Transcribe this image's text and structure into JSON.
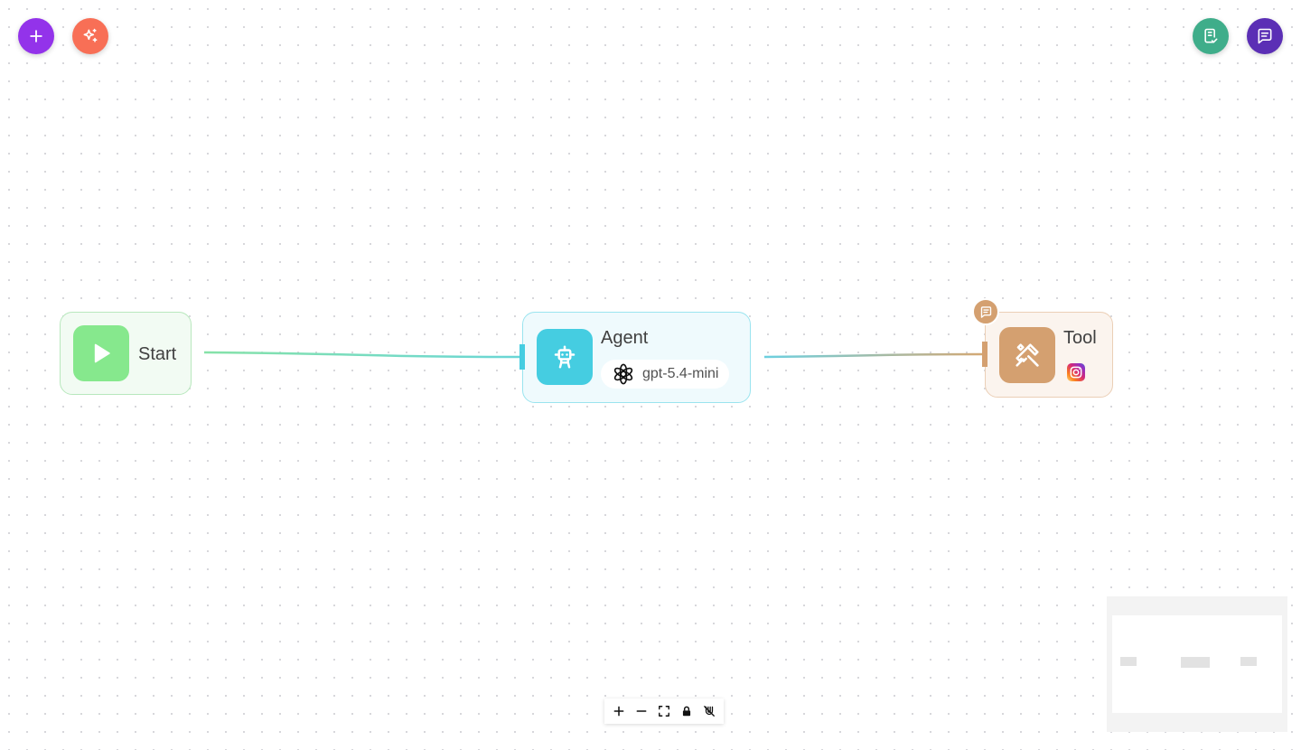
{
  "toolbar": {
    "add_icon": "plus-icon",
    "ai_icon": "sparkles-icon",
    "checklist_icon": "clipboard-check-icon",
    "chat_icon": "message-square-icon"
  },
  "colors": {
    "purple": "#9333ea",
    "coral": "#f86f56",
    "teal": "#3fad8a",
    "indigo": "#5b2fb5",
    "start_green": "#86e88d",
    "agent_cyan": "#45cde1",
    "tool_tan": "#d4a070"
  },
  "nodes": {
    "start": {
      "label": "Start",
      "icon": "play-icon"
    },
    "agent": {
      "label": "Agent",
      "icon": "bot-icon",
      "model": "gpt-5.4-mini",
      "model_icon": "openai-icon"
    },
    "tool": {
      "label": "Tool",
      "icon": "tools-icon",
      "integration_icon": "instagram-icon",
      "note_icon": "message-square-icon"
    }
  },
  "controls": [
    "zoom-in-icon",
    "zoom-out-icon",
    "fit-view-icon",
    "lock-icon",
    "magnet-off-icon"
  ]
}
